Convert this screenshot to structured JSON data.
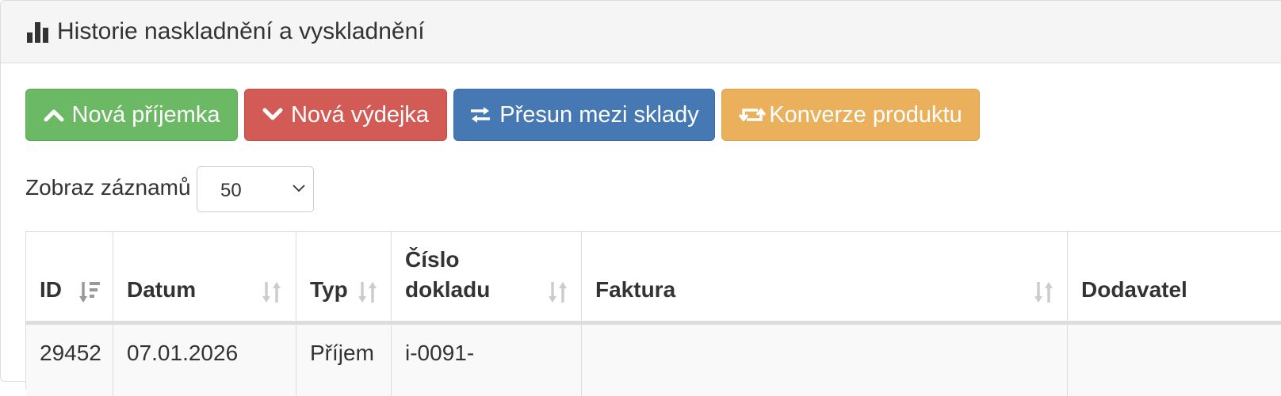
{
  "panel": {
    "title": "Historie naskladnění a vyskladnění",
    "title_icon": "bar-chart-icon"
  },
  "actions": [
    {
      "label": "Nová příjemka",
      "icon": "chevron-up-icon",
      "color": "#6bb865"
    },
    {
      "label": "Nová výdejka",
      "icon": "chevron-down-icon",
      "color": "#d25c55"
    },
    {
      "label": "Přesun mezi sklady",
      "icon": "transfer-icon",
      "color": "#4679b4"
    },
    {
      "label": "Konverze produktu",
      "icon": "retweet-icon",
      "color": "#ebb05b"
    }
  ],
  "length": {
    "label": "Zobraz záznamů",
    "selected": "50"
  },
  "table": {
    "columns": [
      {
        "label": "ID",
        "sort": "desc-active"
      },
      {
        "label": "Datum",
        "sort": "both"
      },
      {
        "label": "Typ",
        "sort": "both"
      },
      {
        "label": "Číslo dokladu",
        "sort": "both"
      },
      {
        "label": "Faktura",
        "sort": "both"
      },
      {
        "label": "Dodavatel",
        "sort": "none"
      }
    ],
    "rows": [
      {
        "id": "29452",
        "date": "07.01.2026",
        "type": "Příjem",
        "doc": "i-0091-",
        "invoice": "",
        "supplier": ""
      }
    ]
  }
}
